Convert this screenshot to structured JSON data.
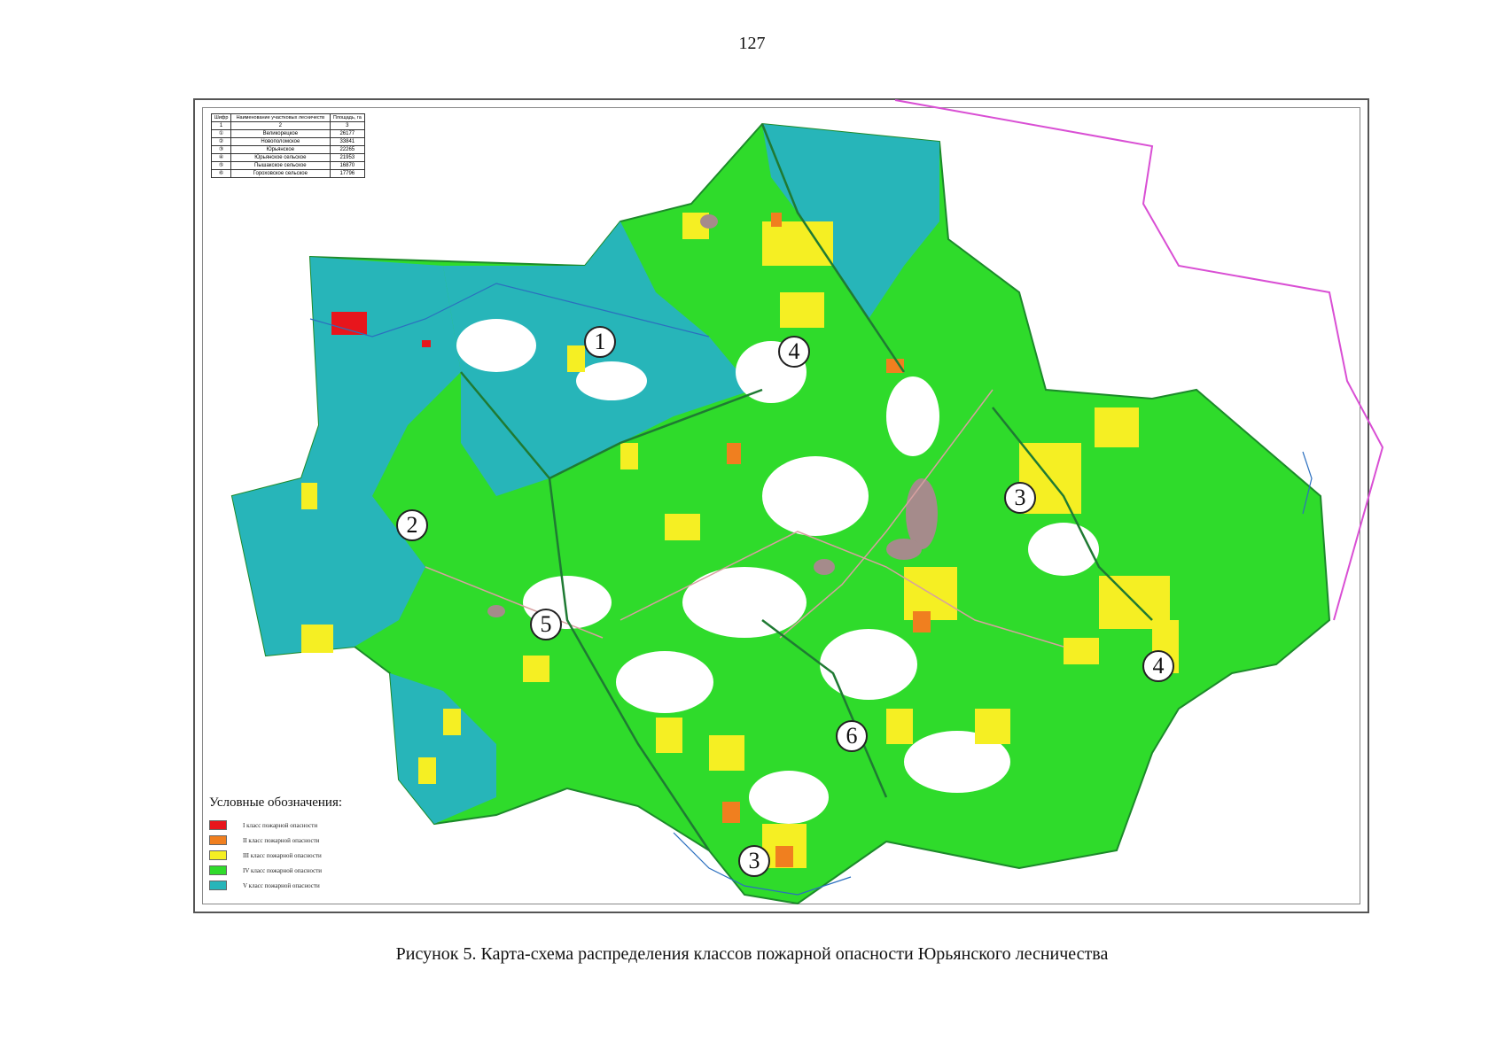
{
  "page_number": "127",
  "caption": "Рисунок 5. Карта-схема распределения классов пожарной опасности Юрьянского лесничества",
  "table": {
    "headers": [
      "Шифр",
      "Наименование участковых лесничеств",
      "Площадь, га"
    ],
    "index_row": [
      "1",
      "2",
      "3"
    ],
    "rows": [
      {
        "code": "①",
        "name": "Великорецкое",
        "area": "26177"
      },
      {
        "code": "②",
        "name": "Новополомское",
        "area": "33841"
      },
      {
        "code": "③",
        "name": "Юрьянское",
        "area": "22265"
      },
      {
        "code": "④",
        "name": "Юрьянское сельское",
        "area": "21953"
      },
      {
        "code": "⑤",
        "name": "Пышакское сельское",
        "area": "16870"
      },
      {
        "code": "⑥",
        "name": "Гороховское сельское",
        "area": "17796"
      }
    ]
  },
  "legend": {
    "title": "Условные обозначения:",
    "items": [
      {
        "label": "I класс пожарной опасности",
        "color": "#e8151c"
      },
      {
        "label": "II класс пожарной опасности",
        "color": "#f07f1f"
      },
      {
        "label": "III класс пожарной опасности",
        "color": "#f5ef23"
      },
      {
        "label": "IV класс пожарной опасности",
        "color": "#2fdb2b"
      },
      {
        "label": "V класс пожарной опасности",
        "color": "#27b5b9"
      }
    ]
  },
  "zone_labels": [
    "1",
    "2",
    "3",
    "4",
    "5",
    "6",
    "3",
    "4",
    "4"
  ],
  "colors": {
    "boundary_magenta": "#d94fd4",
    "class_v": "#27b5b9",
    "class_iv": "#2fdb2b",
    "class_iii": "#f5ef23",
    "class_ii": "#f07f1f",
    "class_i": "#e8151c",
    "settlement": "#a58b8b"
  }
}
